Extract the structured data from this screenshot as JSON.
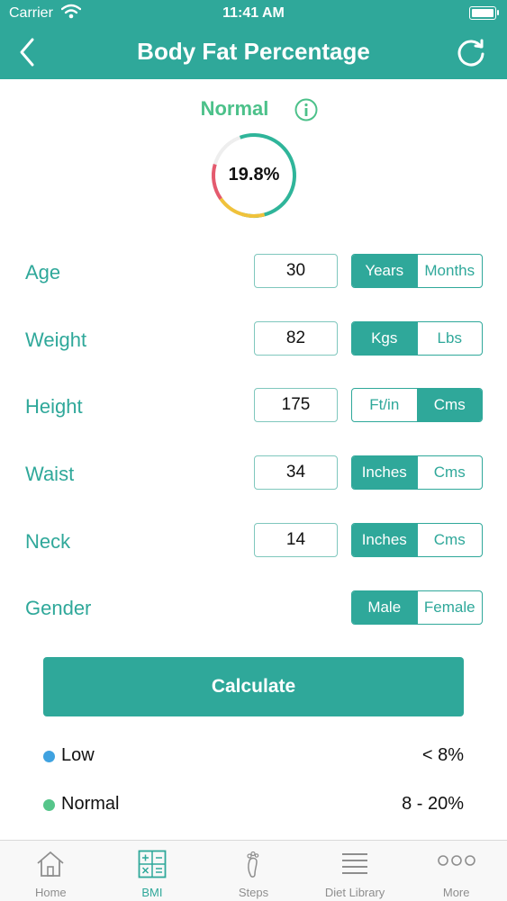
{
  "status_bar": {
    "carrier": "Carrier",
    "time": "11:41 AM"
  },
  "header": {
    "title": "Body Fat Percentage"
  },
  "result": {
    "status": "Normal",
    "value": "19.8%",
    "fraction": 0.198
  },
  "rows": [
    {
      "label": "Age",
      "value": "30",
      "options": [
        "Years",
        "Months"
      ],
      "selected": 0
    },
    {
      "label": "Weight",
      "value": "82",
      "options": [
        "Kgs",
        "Lbs"
      ],
      "selected": 0
    },
    {
      "label": "Height",
      "value": "175",
      "options": [
        "Ft/in",
        "Cms"
      ],
      "selected": 1
    },
    {
      "label": "Waist",
      "value": "34",
      "options": [
        "Inches",
        "Cms"
      ],
      "selected": 0
    },
    {
      "label": "Neck",
      "value": "14",
      "options": [
        "Inches",
        "Cms"
      ],
      "selected": 0
    },
    {
      "label": "Gender",
      "options": [
        "Male",
        "Female"
      ],
      "selected": 0
    }
  ],
  "calculate_label": "Calculate",
  "ranges": [
    {
      "name": "Low",
      "value": "< 8%",
      "color": "#3fa2e0"
    },
    {
      "name": "Normal",
      "value": "8 - 20%",
      "color": "#56c58a"
    }
  ],
  "tabs": [
    {
      "label": "Home",
      "icon": "home-icon"
    },
    {
      "label": "BMI",
      "icon": "calculator-icon",
      "active": true
    },
    {
      "label": "Steps",
      "icon": "footprint-icon"
    },
    {
      "label": "Diet Library",
      "icon": "list-icon"
    },
    {
      "label": "More",
      "icon": "more-icon"
    }
  ],
  "colors": {
    "accent": "#2fa89a",
    "normal": "#4cc18a"
  }
}
